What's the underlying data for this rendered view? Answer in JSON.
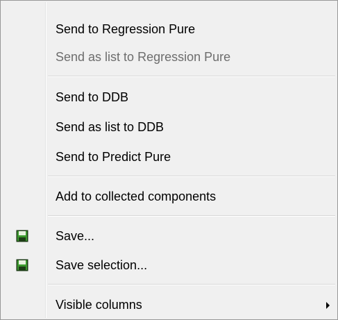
{
  "menu": {
    "items": [
      {
        "label": "Send to Regression Pure",
        "enabled": true
      },
      {
        "label": "Send as list to Regression Pure",
        "enabled": false
      },
      {
        "label": "Send to DDB",
        "enabled": true
      },
      {
        "label": "Send as list to DDB",
        "enabled": true
      },
      {
        "label": "Send to Predict Pure",
        "enabled": true
      },
      {
        "label": "Add to collected components",
        "enabled": true
      },
      {
        "label": "Save...",
        "enabled": true,
        "icon": "floppy-disk-icon"
      },
      {
        "label": "Save selection...",
        "enabled": true,
        "icon": "floppy-disk-icon"
      },
      {
        "label": "Visible columns",
        "enabled": true,
        "submenu": true
      }
    ]
  },
  "colors": {
    "background": "#f0f0f0",
    "disabled_text": "#6d6d6d",
    "icon_green": "#3c9a2e",
    "icon_dark": "#1d3d16"
  }
}
